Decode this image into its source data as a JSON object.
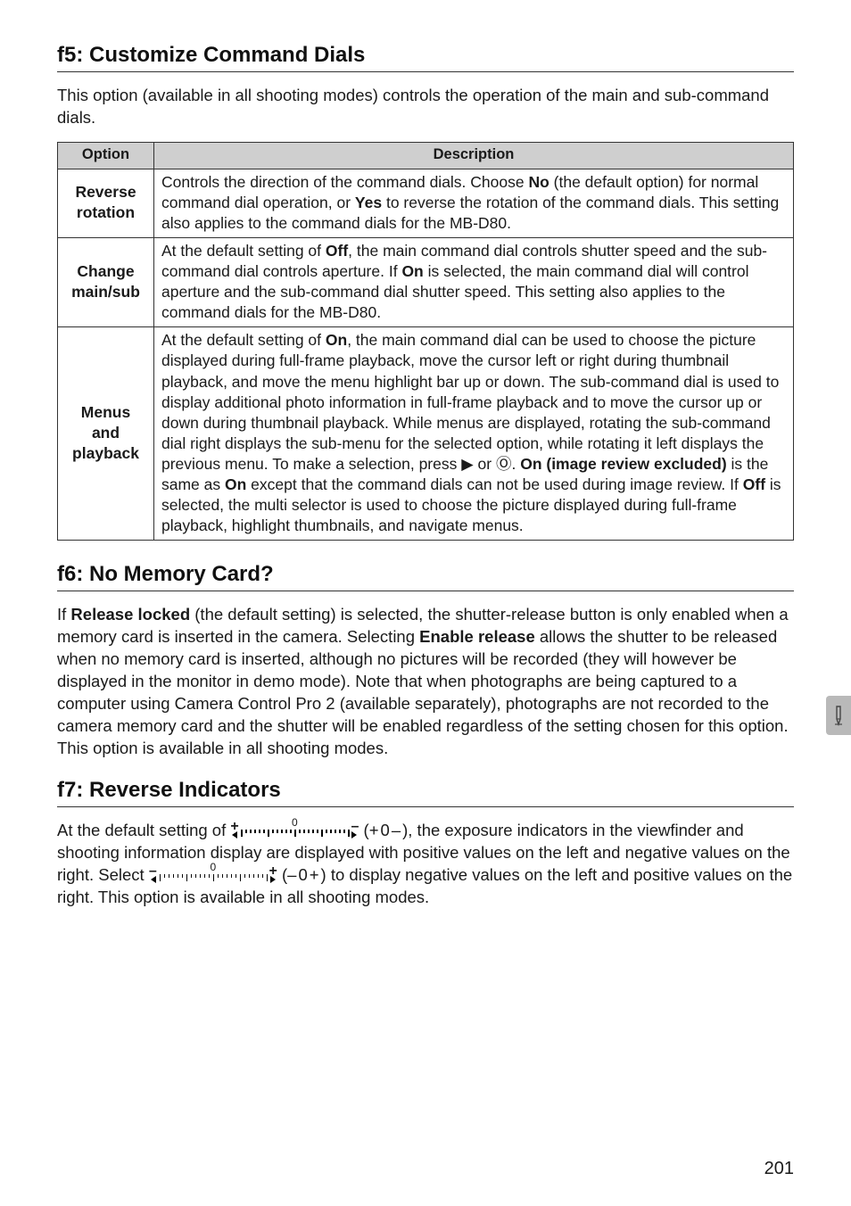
{
  "sections": {
    "f5": {
      "title": "f5: Customize Command Dials",
      "intro": "This option (available in all shooting modes) controls the operation of the main and sub-command dials.",
      "table": {
        "head_option": "Option",
        "head_desc": "Description",
        "rows": [
          {
            "option_line1": "Reverse",
            "option_line2": "rotation",
            "desc_parts": [
              "Controls the direction of the command dials.  Choose ",
              "No",
              " (the default option) for normal command dial operation, or ",
              "Yes",
              " to reverse the rotation of the command dials.  This setting also applies to the command dials for the MB-D80."
            ]
          },
          {
            "option_line1": "Change",
            "option_line2": "main/sub",
            "desc_parts": [
              "At the default setting of ",
              "Off",
              ", the main command dial controls shutter speed and the sub-command dial controls aperture.  If ",
              "On",
              " is selected, the main command dial will control aperture and the sub-command dial shutter speed.  This setting also applies to the command dials for the MB-D80."
            ]
          },
          {
            "option_line1": "Menus",
            "option_line2": "and",
            "option_line3": "playback",
            "desc_parts": [
              "At the default setting of ",
              "On",
              ", the main command dial can be used to choose the picture displayed during full-frame playback, move the cursor left or right during thumbnail playback, and move the menu highlight bar up or down.  The sub-command dial is used to display additional photo information in full-frame playback and to move the cursor up or down during thumbnail playback.  While menus are displayed, rotating the sub-command dial right displays the sub-menu for the selected option, while rotating it left displays the previous menu.  To make a selection, press ▶ or Ⓞ.  ",
              "On (image review excluded)",
              " is the same as ",
              "On",
              " except that the command dials can not be used during image review.  If ",
              "Off",
              " is selected, the multi selector is used to choose the picture displayed during full-frame playback, highlight thumbnails, and navigate menus."
            ]
          }
        ]
      }
    },
    "f6": {
      "title": "f6: No Memory Card?",
      "body_parts": [
        "If ",
        "Release locked",
        " (the default setting) is selected, the shutter-release button is only enabled when a memory card is inserted in the camera.  Selecting ",
        "Enable release",
        " allows the shutter to be released when no memory card is inserted, although no pictures will be recorded (they will however be displayed in the monitor in demo mode).  Note that when photographs are being captured to a computer using Camera Control Pro 2 (available separately), photographs are not recorded to the camera memory card and the shutter will be enabled regardless of the setting chosen for this option.  This option is available in all shooting modes."
      ]
    },
    "f7": {
      "title": "f7: Reverse Indicators",
      "body_pre": "At the default setting of ",
      "body_mid1": " (",
      "label_plus": "+",
      "label_zero": "0",
      "label_minus": "–",
      "body_mid2": "), the exposure indicators in the viewfinder and shooting information display are displayed with positive values on the left and negative values on the right.  Select ",
      "body_mid3": " (",
      "body_mid4": ") to display negative values on the left and positive values on the right.  This option is available in all shooting modes."
    }
  },
  "sideTab": {
    "icon_name": "pencil-icon"
  },
  "pageNumber": "201"
}
